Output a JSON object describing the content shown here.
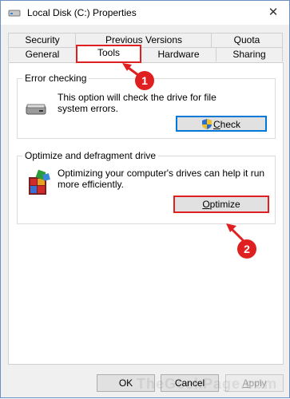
{
  "window": {
    "title": "Local Disk (C:) Properties",
    "close_glyph": "✕"
  },
  "tabs_row1": [
    "Security",
    "Previous Versions",
    "Quota"
  ],
  "tabs_row2": [
    "General",
    "Tools",
    "Hardware",
    "Sharing"
  ],
  "error_checking": {
    "label": "Error checking",
    "description": "This option will check the drive for file system errors.",
    "button": {
      "prefix": "",
      "accel": "C",
      "rest": "heck"
    }
  },
  "optimize": {
    "label": "Optimize and defragment drive",
    "description": "Optimizing your computer's drives can help it run more efficiently.",
    "button": {
      "accel": "O",
      "rest": "ptimize"
    }
  },
  "footer": {
    "ok": "OK",
    "cancel": {
      "accel": "",
      "label": "Cancel"
    },
    "apply": {
      "accel": "A",
      "rest": "pply"
    }
  },
  "markers": [
    "1",
    "2"
  ],
  "watermark": "TheGeekPage.com"
}
